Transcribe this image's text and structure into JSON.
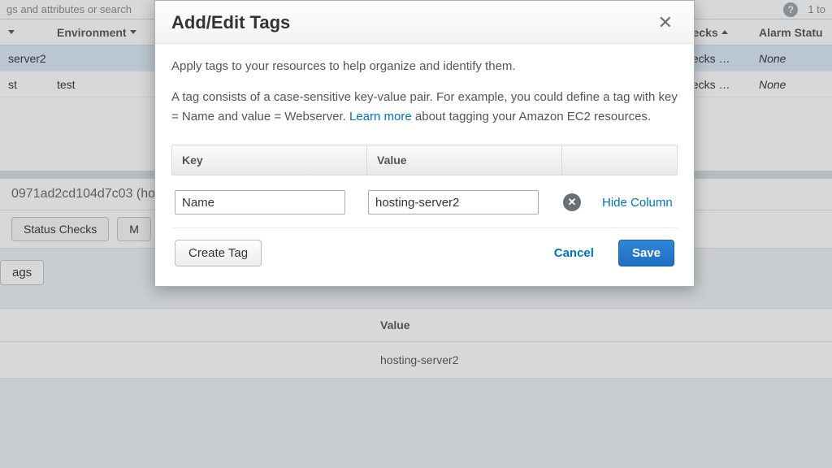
{
  "bg": {
    "search_placeholder": "gs and attributes or search",
    "pager": "1 to",
    "columns": {
      "env": "Environment",
      "checks": "hecks",
      "alarm": "Alarm Statu"
    },
    "rows": [
      {
        "name": "server2",
        "env": "",
        "checks": "hecks …",
        "alarm": "None"
      },
      {
        "name": "st",
        "env": "test",
        "checks": "hecks …",
        "alarm": "None"
      }
    ],
    "instance_detail": "0971ad2cd104d7c03 (ho",
    "tabs": {
      "status_checks": "Status Checks",
      "m": "M"
    },
    "subtab": "ags",
    "value_header": "Value",
    "value_row": "hosting-server2"
  },
  "modal": {
    "title": "Add/Edit Tags",
    "intro": "Apply tags to your resources to help organize and identify them.",
    "desc_a": "A tag consists of a case-sensitive key-value pair. For example, you could define a tag with key = Name and value = Webserver. ",
    "learn_more": "Learn more",
    "desc_b": " about tagging your Amazon EC2 resources.",
    "headers": {
      "key": "Key",
      "value": "Value"
    },
    "tag": {
      "key": "Name",
      "value": "hosting-server2"
    },
    "hide_column": "Hide Column",
    "buttons": {
      "create": "Create Tag",
      "cancel": "Cancel",
      "save": "Save"
    }
  }
}
